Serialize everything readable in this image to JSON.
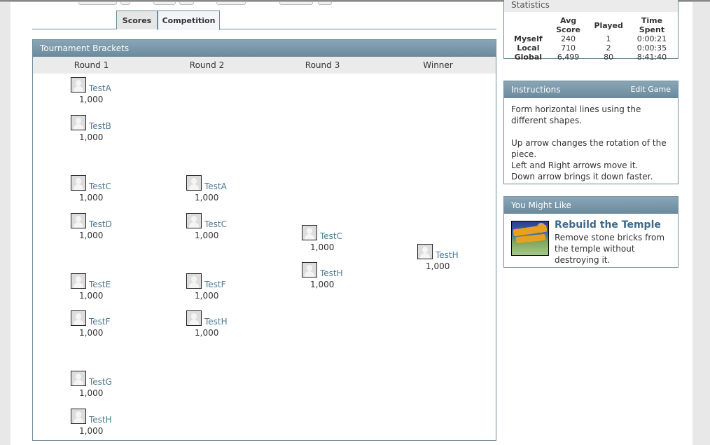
{
  "tabs": [
    {
      "label": "Scores",
      "active": false
    },
    {
      "label": "Competition",
      "active": true
    }
  ],
  "brackets": {
    "title": "Tournament Brackets",
    "columns": [
      "Round 1",
      "Round 2",
      "Round 3",
      "Winner"
    ],
    "round1": [
      {
        "name": "TestA",
        "score": "1,000"
      },
      {
        "name": "TestB",
        "score": "1,000"
      },
      {
        "name": "TestC",
        "score": "1,000"
      },
      {
        "name": "TestD",
        "score": "1,000"
      },
      {
        "name": "TestE",
        "score": "1,000"
      },
      {
        "name": "TestF",
        "score": "1,000"
      },
      {
        "name": "TestG",
        "score": "1,000"
      },
      {
        "name": "TestH",
        "score": "1,000"
      }
    ],
    "round2": [
      {
        "name": "TestA",
        "score": "1,000"
      },
      {
        "name": "TestC",
        "score": "1,000"
      },
      {
        "name": "TestF",
        "score": "1,000"
      },
      {
        "name": "TestH",
        "score": "1,000"
      }
    ],
    "round3": [
      {
        "name": "TestC",
        "score": "1,000"
      },
      {
        "name": "TestH",
        "score": "1,000"
      }
    ],
    "winner": [
      {
        "name": "TestH",
        "score": "1,000"
      }
    ]
  },
  "statistics": {
    "title": "Statistics",
    "headers": [
      "Avg Score",
      "Played",
      "Time Spent"
    ],
    "rows": [
      {
        "label": "Myself",
        "avg": "240",
        "played": "1",
        "time": "0:00:21"
      },
      {
        "label": "Local",
        "avg": "710",
        "played": "2",
        "time": "0:00:35"
      },
      {
        "label": "Global",
        "avg": "6,499",
        "played": "80",
        "time": "8:41:40"
      }
    ]
  },
  "instructions": {
    "title": "Instructions",
    "edit_label": "Edit Game",
    "lines": [
      "Form horizontal lines using the different shapes.",
      "",
      "Up arrow changes the rotation of the piece.",
      "Left and Right arrows move it.",
      "Down arrow brings it down faster."
    ]
  },
  "you_might_like": {
    "title": "You Might Like",
    "game_title": "Rebuild the Temple",
    "game_description": "Remove stone bricks from the temple without destroying it.",
    "thumbnail_icon": "rebuild-the-temple-thumbnail"
  }
}
